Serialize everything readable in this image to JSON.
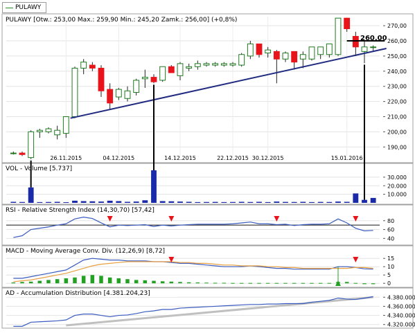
{
  "legend": {
    "label": "PULAWY",
    "color": "#2a8a2a"
  },
  "colors": {
    "up_fill": "#ffffff",
    "up_border": "#1f7a1f",
    "down_fill": "#e8141b",
    "trend": "#1f2a80",
    "volume": "#1a2aa8",
    "rsi": "#3a5bbf",
    "macd_line": "#3a5bbf",
    "macd_signal": "#e8a040",
    "macd_hist": "#22a022",
    "ad_line": "#3a5bbf",
    "ad_trend": "#c0c0c0",
    "marker": "#e8141b",
    "buy_marker": "#22a022"
  },
  "price_panel": {
    "header": "PULAWY [Otw.: 253,00  Max.: 259,90  Min.: 245,20  Zamk.: 256,00] (+0,8%)",
    "last_price_label": "260,00"
  },
  "volume_panel": {
    "header": "VOL - Volume [5.737]"
  },
  "rsi_panel": {
    "header": "RSI - Relative Strength Index (14,30,70) [57,42]"
  },
  "macd_panel": {
    "header": "MACD - Moving Average Conv. Div. (12,26,9) [8,72]"
  },
  "ad_panel": {
    "header": "AD - Accumulation Distribution [4.381.204,23]"
  },
  "chart_data": [
    {
      "type": "candlestick",
      "title": "PULAWY",
      "x_tick_labels": [
        "26.11.2015",
        "04.12.2015",
        "14.12.2015",
        "22.12.2015",
        "30.12.2015",
        "15.01.2016"
      ],
      "x_tick_index": [
        6,
        12,
        19,
        25,
        29,
        38
      ],
      "y_ticks": [
        190,
        200,
        210,
        220,
        230,
        240,
        250,
        260,
        270
      ],
      "y_tick_labels": [
        "190,00",
        "200,00",
        "210,00",
        "220,00",
        "230,00",
        "240,00",
        "250,00",
        "260,00",
        "270,00"
      ],
      "ylim": [
        181,
        276
      ],
      "n": 42,
      "ohlc": [
        [
          186,
          187,
          185,
          186
        ],
        [
          186,
          187,
          184,
          185
        ],
        [
          183,
          201,
          182,
          200
        ],
        [
          200,
          202,
          196,
          201
        ],
        [
          200,
          203,
          199,
          202
        ],
        [
          198,
          204,
          195,
          201
        ],
        [
          199,
          210,
          196,
          210
        ],
        [
          210,
          243,
          209,
          242
        ],
        [
          242,
          248,
          238,
          246
        ],
        [
          244,
          246,
          240,
          242
        ],
        [
          242,
          244,
          223,
          227
        ],
        [
          228,
          232,
          215,
          219
        ],
        [
          223,
          229,
          221,
          228
        ],
        [
          222,
          230,
          220,
          227
        ],
        [
          226,
          235,
          224,
          234
        ],
        [
          235,
          241,
          229,
          236
        ],
        [
          236,
          238,
          232,
          233
        ],
        [
          234,
          242,
          233,
          243
        ],
        [
          243,
          244,
          239,
          239
        ],
        [
          237,
          246,
          234,
          245
        ],
        [
          242,
          245,
          240,
          243
        ],
        [
          243,
          247,
          241,
          245
        ],
        [
          244,
          246,
          243,
          245
        ],
        [
          244,
          246,
          243,
          245
        ],
        [
          244,
          246,
          243,
          245
        ],
        [
          244,
          246,
          243,
          245
        ],
        [
          244,
          252,
          243,
          251
        ],
        [
          250,
          260,
          248,
          258
        ],
        [
          258,
          258,
          249,
          251
        ],
        [
          252,
          256,
          249,
          254
        ],
        [
          253,
          254,
          232,
          248
        ],
        [
          248,
          253,
          246,
          252
        ],
        [
          253,
          253,
          241,
          246
        ],
        [
          248,
          253,
          242,
          251
        ],
        [
          248,
          255,
          247,
          256
        ],
        [
          251,
          256,
          248,
          256
        ],
        [
          251,
          258,
          249,
          258
        ],
        [
          251,
          275,
          250,
          275
        ],
        [
          275,
          275,
          266,
          268
        ],
        [
          263,
          266,
          250,
          256
        ],
        [
          253,
          259.9,
          245.2,
          256
        ],
        [
          256,
          257,
          253,
          256
        ]
      ],
      "trend_line": {
        "x": [
          7,
          42
        ],
        "y": [
          209,
          255
        ]
      },
      "horizontal_level": 260.0
    },
    {
      "type": "bar",
      "title": "VOL - Volume [5.737]",
      "y_ticks": [
        10000,
        20000,
        30000
      ],
      "y_tick_labels": [
        "10.000",
        "20.000",
        "30.000"
      ],
      "ylim": [
        0,
        38000
      ],
      "values": [
        1200,
        1000,
        18000,
        900,
        1000,
        1200,
        800,
        2500,
        2000,
        1800,
        1500,
        2500,
        2000,
        1200,
        1500,
        3000,
        38000,
        2000,
        1800,
        1500,
        1200,
        900,
        1000,
        1100,
        900,
        1000,
        1200,
        1000,
        1200,
        900,
        1500,
        1100,
        1000,
        1200,
        900,
        1100,
        1000,
        1500,
        1200,
        11000,
        3500,
        5737
      ]
    },
    {
      "type": "line",
      "title": "RSI - Relative Strength Index (14,30,70) [57,42]",
      "y_ticks": [
        40,
        60,
        80
      ],
      "y_tick_labels": [
        "40",
        "60",
        "80"
      ],
      "ylim": [
        28,
        100
      ],
      "threshold": 70,
      "values": [
        42,
        46,
        60,
        63,
        66,
        70,
        73,
        84,
        88,
        85,
        75,
        66,
        70,
        69,
        70,
        71,
        67,
        70,
        68,
        70,
        71,
        72,
        72,
        72,
        72,
        73,
        75,
        77,
        73,
        73,
        71,
        72,
        69,
        71,
        72,
        72,
        73,
        84,
        75,
        63,
        57,
        58
      ],
      "sell_markers": [
        11,
        18,
        30,
        39
      ]
    },
    {
      "type": "line",
      "title": "MACD - Moving Average Conv. Div. (12,26,9) [8,72]",
      "y_ticks": [
        0,
        5,
        10,
        15
      ],
      "y_tick_labels": [
        "0",
        "5",
        "10",
        "15"
      ],
      "ylim": [
        -2,
        18
      ],
      "series": [
        {
          "values": [
            3,
            3,
            4,
            5,
            6,
            7,
            8,
            11,
            14,
            15,
            14.5,
            14,
            14,
            13.5,
            13.5,
            13.5,
            13,
            13,
            12.5,
            12,
            12,
            11.5,
            11,
            10.5,
            10,
            10,
            10,
            10.5,
            10,
            9.5,
            9,
            9,
            8.5,
            8.5,
            8.5,
            8.5,
            8.5,
            10,
            10,
            9.5,
            8.7,
            8.5
          ]
        },
        {
          "values": [
            1,
            1.5,
            2,
            3,
            4,
            5,
            6,
            7.5,
            9,
            10.5,
            11.5,
            12,
            12.5,
            13,
            13,
            13,
            13,
            13,
            13,
            12.5,
            12.5,
            12,
            12,
            11.5,
            11,
            11,
            10.5,
            10.5,
            10.5,
            10,
            10,
            9.5,
            9.5,
            9,
            9,
            9,
            9,
            9,
            9,
            9.5,
            9.5,
            9
          ]
        }
      ],
      "histogram": [
        0.5,
        0.8,
        1,
        1.5,
        2,
        2.5,
        3,
        3.5,
        4.5,
        5,
        4.5,
        3.5,
        3,
        2.5,
        2,
        1.8,
        1.5,
        1.2,
        1,
        0.8,
        0.6,
        0.5,
        0.4,
        0.3,
        0.3,
        0.2,
        0.2,
        0.2,
        0.2,
        0.2,
        0.2,
        0.2,
        0.2,
        0.2,
        0.2,
        0.2,
        0.2,
        0.8,
        0.8,
        0.2,
        -0.5,
        -0.5
      ],
      "sell_markers": [
        18,
        39
      ],
      "buy_markers": [
        37
      ]
    },
    {
      "type": "line",
      "title": "AD - Accumulation Distribution [4.381.204,23]",
      "y_ticks": [
        4320000,
        4340000,
        4360000,
        4380000
      ],
      "y_tick_labels": [
        "4.320.000",
        "4.340.000",
        "4.360.000",
        "4.380.000"
      ],
      "ylim": [
        4315000,
        4385000
      ],
      "values": [
        4316000,
        4316000,
        4325000,
        4326000,
        4327000,
        4328000,
        4330000,
        4340000,
        4343000,
        4343000,
        4340000,
        4337000,
        4340000,
        4341000,
        4344000,
        4348000,
        4350000,
        4353000,
        4353000,
        4356000,
        4357000,
        4358000,
        4359000,
        4360000,
        4361000,
        4362000,
        4363000,
        4364000,
        4364000,
        4365000,
        4365000,
        4366000,
        4366000,
        4366000,
        4369000,
        4371000,
        4373000,
        4378000,
        4376000,
        4375000,
        4378000,
        4381204
      ],
      "trend_line": {
        "x": [
          6,
          41
        ],
        "y": [
          4318000,
          4380000
        ]
      }
    }
  ]
}
